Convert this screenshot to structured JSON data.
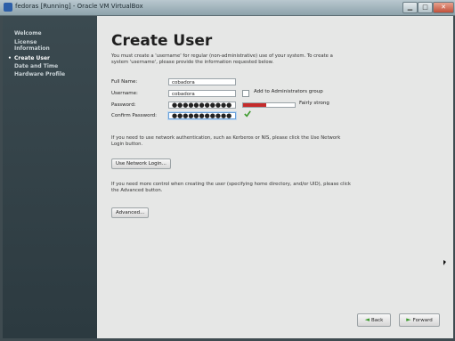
{
  "window": {
    "title": "fedoras [Running] - Oracle VM VirtualBox",
    "min_glyph": "▁",
    "max_glyph": "□",
    "close_glyph": "✕"
  },
  "sidebar": {
    "items": [
      {
        "label": "Welcome"
      },
      {
        "label": "License\nInformation"
      },
      {
        "label": "Create User"
      },
      {
        "label": "Date and Time"
      },
      {
        "label": "Hardware Profile"
      }
    ],
    "active_bullet": "•"
  },
  "main": {
    "title": "Create User",
    "intro": "You must create a 'username' for regular (non-administrative) use of your system.  To create a system 'username', please provide the information requested below.",
    "fields": {
      "full_name_label": "Full Name:",
      "full_name_value": "cobadora",
      "username_label": "Username:",
      "username_value": "cobadora",
      "password_label": "Password:",
      "password_value": "●●●●●●●●●●●",
      "confirm_label": "Confirm Password:",
      "confirm_value": "●●●●●●●●●●●"
    },
    "admin_checkbox_label": "Add to Administrators group",
    "admin_checked": false,
    "strength": {
      "label": "Fairly strong",
      "level": 0.45,
      "color": "#c52b2b"
    },
    "network_text": "If you need to use network authentication, such as Kerberos or NIS, please click the Use Network Login button.",
    "network_button": "Use Network Login...",
    "advanced_text": "If you need more control when creating the user (specifying home directory, and/or UID), please click the Advanced button.",
    "advanced_button": "Advanced...",
    "back_button": "Back",
    "forward_button": "Forward"
  },
  "colors": {
    "accent": "#3c9a2c",
    "sidebar_bg": "#2c3a40"
  }
}
